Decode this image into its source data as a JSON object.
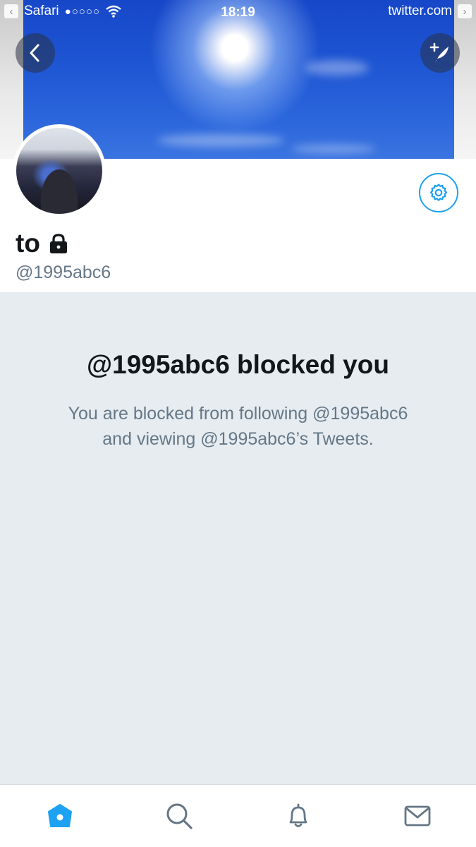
{
  "status_bar": {
    "app_back": "Safari",
    "signal": "●○○○○",
    "time": "18:19",
    "site": "twitter.com"
  },
  "profile": {
    "display_name": "to",
    "handle": "@1995abc6",
    "protected": true
  },
  "blocked": {
    "title": "@1995abc6 blocked you",
    "line1": "You are blocked from following @1995abc6",
    "line2": "and viewing @1995abc6’s Tweets."
  },
  "tabs": [
    {
      "name": "home",
      "icon": "home-icon",
      "active": true
    },
    {
      "name": "search",
      "icon": "search-icon",
      "active": false
    },
    {
      "name": "notifications",
      "icon": "bell-icon",
      "active": false
    },
    {
      "name": "messages",
      "icon": "mail-icon",
      "active": false
    }
  ],
  "colors": {
    "accent": "#1da1f2",
    "panel": "#e6ecf0",
    "secondary_text": "#657786"
  }
}
